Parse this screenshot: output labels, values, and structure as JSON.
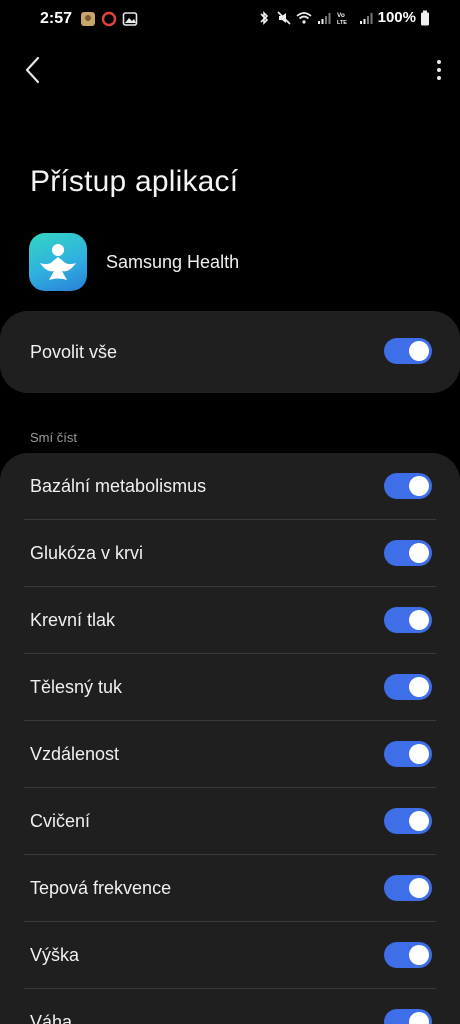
{
  "status_bar": {
    "time": "2:57",
    "battery": "100%",
    "icons_left": [
      "notification-app-icon",
      "circle-record-icon",
      "gallery-icon"
    ],
    "icons_right": [
      "bluetooth-icon",
      "mute-icon",
      "wifi-icon",
      "signal-icon",
      "volte-icon",
      "signal-icon",
      "battery-icon"
    ]
  },
  "header": {
    "back_icon": "chevron-left-icon",
    "more_icon": "more-vertical-icon"
  },
  "page": {
    "title": "Přístup aplikací",
    "app_name": "Samsung Health",
    "app_icon": "samsung-health-icon"
  },
  "allow_all": {
    "label": "Povolit vše",
    "enabled": true
  },
  "section": {
    "header": "Smí číst"
  },
  "permissions": [
    {
      "label": "Bazální metabolismus",
      "enabled": true
    },
    {
      "label": "Glukóza v krvi",
      "enabled": true
    },
    {
      "label": "Krevní tlak",
      "enabled": true
    },
    {
      "label": "Tělesný tuk",
      "enabled": true
    },
    {
      "label": "Vzdálenost",
      "enabled": true
    },
    {
      "label": "Cvičení",
      "enabled": true
    },
    {
      "label": "Tepová frekvence",
      "enabled": true
    },
    {
      "label": "Výška",
      "enabled": true
    },
    {
      "label": "Váha",
      "enabled": true
    }
  ],
  "colors": {
    "accent": "#3e6fe8",
    "card": "#1f1f1f",
    "background": "#000000"
  }
}
